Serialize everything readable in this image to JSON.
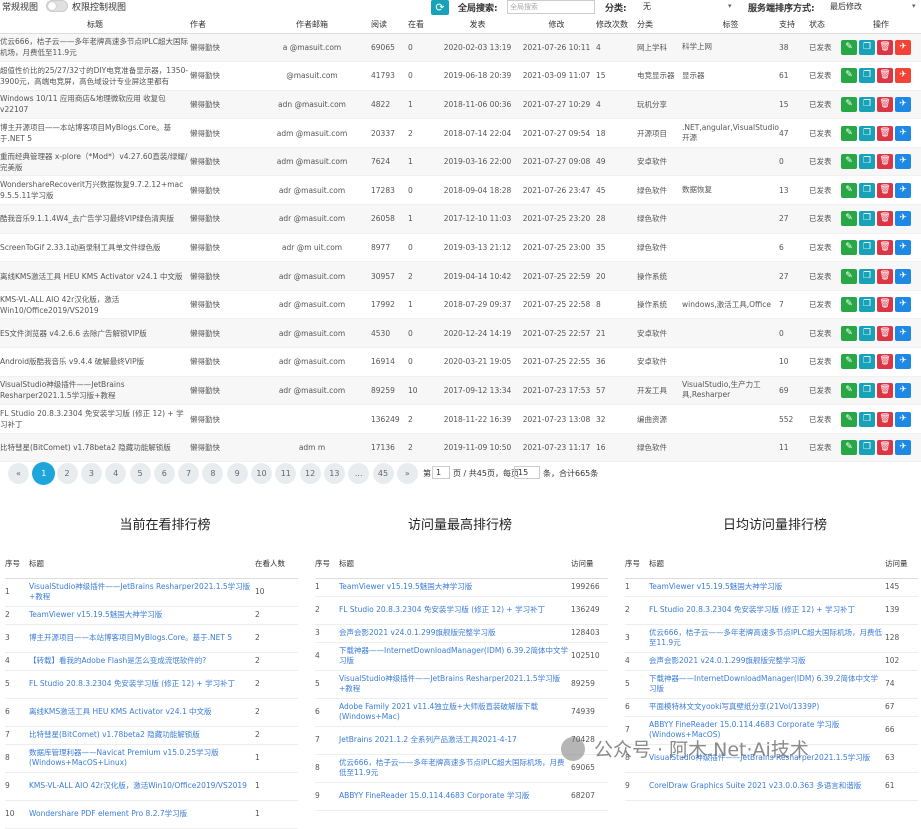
{
  "topbar": {
    "view1": "常规视图",
    "view2": "权限控制视图",
    "global_search_label": "全局搜索:",
    "search_placeholder": "全局搜索",
    "category_label": "分类:",
    "category_value": "无",
    "sort_label": "服务端排序方式:",
    "sort_value": "最后修改"
  },
  "table": {
    "headers": [
      "标题",
      "作者",
      "作者邮箱",
      "阅读",
      "在看",
      "发表",
      "修改",
      "修改次数",
      "分类",
      "标签",
      "支持",
      "状态",
      "操作"
    ],
    "rows": [
      {
        "title": "优云666，桔子云——多年老牌高速多节点IPLC超大国际机场，月费低至11.9元",
        "author": "懒得勤快",
        "email": "a    @masuit.com",
        "reads": "69065",
        "watch": "0",
        "pub": "2020-02-03 13:19",
        "mod": "2021-07-26 10:11",
        "times": "4",
        "cat": "网上学科",
        "tags": "科学上网",
        "support": "38",
        "status": "已发表",
        "extra": true
      },
      {
        "title": "超值性价比的25/27/32寸的DIY电竞准备显示器，1350-3900元，高端电竞屏，高色域设计专业屏这里都有",
        "author": "懒得勤快",
        "email": "    @masuit.com",
        "reads": "41793",
        "watch": "0",
        "pub": "2019-06-18 20:39",
        "mod": "2021-03-09 11:07",
        "times": "15",
        "cat": "电竞显示器",
        "tags": "显示器",
        "support": "61",
        "status": "已发表",
        "extra": true
      },
      {
        "title": "Windows 10/11 应用商店&地理微软应用 收复包v22107",
        "author": "懒得勤快",
        "email": "adn   @masuit.com",
        "reads": "4822",
        "watch": "1",
        "pub": "2018-11-06 00:36",
        "mod": "2021-07-27 10:29",
        "times": "4",
        "cat": "玩机分享",
        "tags": "",
        "support": "15",
        "status": "已发表",
        "extra": false
      },
      {
        "title": "博主开源项目——本站博客项目MyBlogs.Core。基于.NET 5",
        "author": "懒得勤快",
        "email": "adm  @masuit.com",
        "reads": "20337",
        "watch": "2",
        "pub": "2018-07-14 22:04",
        "mod": "2021-07-27 09:54",
        "times": "18",
        "cat": "开源项目",
        "tags": ".NET,angular,VisualStudio,开源",
        "support": "47",
        "status": "已发表",
        "extra": false
      },
      {
        "title": "重而经典管理器 x-plore（*Mod*）v4.27.60直装/绿耀/完美版",
        "author": "懒得勤快",
        "email": "adm  @masuit.com",
        "reads": "7624",
        "watch": "1",
        "pub": "2019-03-16 22:00",
        "mod": "2021-07-27 09:08",
        "times": "49",
        "cat": "安卓软件",
        "tags": "",
        "support": "0",
        "status": "已发表",
        "extra": false
      },
      {
        "title": "WondershareRecoverit万兴数据恢复9.7.2.12+mac 9.5.5.11学习版",
        "author": "懒得勤快",
        "email": "adr   @masuit.com",
        "reads": "17283",
        "watch": "0",
        "pub": "2018-09-04 18:28",
        "mod": "2021-07-26 23:47",
        "times": "45",
        "cat": "绿色软件",
        "tags": "数据恢复",
        "support": "13",
        "status": "已发表",
        "extra": false
      },
      {
        "title": "酷我音乐9.1.1.4W4_去广告学习最终VIP绿色清爽版",
        "author": "懒得勤快",
        "email": "adr   @masuit.com",
        "reads": "26058",
        "watch": "1",
        "pub": "2017-12-10 11:03",
        "mod": "2021-07-25 23:20",
        "times": "28",
        "cat": "绿色软件",
        "tags": "",
        "support": "27",
        "status": "已发表",
        "extra": false
      },
      {
        "title": "ScreenToGif 2.33.1动画录制工具单文件绿色版",
        "author": "懒得勤快",
        "email": "adr   @m  uit.com",
        "reads": "8977",
        "watch": "0",
        "pub": "2019-03-13 21:12",
        "mod": "2021-07-25 23:00",
        "times": "35",
        "cat": "绿色软件",
        "tags": "",
        "support": "6",
        "status": "已发表",
        "extra": false
      },
      {
        "title": "离线KMS激活工具 HEU KMS Activator v24.1 中文版",
        "author": "懒得勤快",
        "email": "adr   @masuit.com",
        "reads": "30957",
        "watch": "2",
        "pub": "2019-04-14 10:42",
        "mod": "2021-07-25 22:59",
        "times": "20",
        "cat": "操作系统",
        "tags": "",
        "support": "27",
        "status": "已发表",
        "extra": false
      },
      {
        "title": "KMS-VL-ALL AIO 42r汉化版，激活Win10/Office2019/VS2019",
        "author": "懒得勤快",
        "email": "adr  @masuit.com",
        "reads": "17992",
        "watch": "1",
        "pub": "2018-07-29 09:37",
        "mod": "2021-07-25 22:58",
        "times": "8",
        "cat": "操作系统",
        "tags": "windows,激活工具,Office",
        "support": "7",
        "status": "已发表",
        "extra": false
      },
      {
        "title": "ES文件浏览器 v4.2.6.6 去除广告解锁VIP版",
        "author": "懒得勤快",
        "email": "adr  @masuit.com",
        "reads": "4530",
        "watch": "0",
        "pub": "2020-12-24 14:19",
        "mod": "2021-07-25 22:57",
        "times": "21",
        "cat": "安卓软件",
        "tags": "",
        "support": "0",
        "status": "已发表",
        "extra": false
      },
      {
        "title": "Android版酷我音乐 v9.4.4 破解最终VIP版",
        "author": "懒得勤快",
        "email": "adr  @masuit.com",
        "reads": "16914",
        "watch": "0",
        "pub": "2020-03-21 19:05",
        "mod": "2021-07-25 22:55",
        "times": "36",
        "cat": "安卓软件",
        "tags": "",
        "support": "10",
        "status": "已发表",
        "extra": false
      },
      {
        "title": "VisualStudio神级插件——JetBrains Resharper2021.1.5学习版+教程",
        "author": "懒得勤快",
        "email": "adr  @masuit.com",
        "reads": "89259",
        "watch": "10",
        "pub": "2017-09-12 13:34",
        "mod": "2021-07-23 17:53",
        "times": "57",
        "cat": "开发工具",
        "tags": "VisualStudio,生产力工具,Resharper",
        "support": "69",
        "status": "已发表",
        "extra": false
      },
      {
        "title": "FL Studio 20.8.3.2304 免安装学习版 (修正 12) + 学习补丁",
        "author": "懒得勤快",
        "email": "",
        "reads": "136249",
        "watch": "2",
        "pub": "2018-11-22 16:39",
        "mod": "2021-07-23 13:08",
        "times": "32",
        "cat": "编曲资源",
        "tags": "",
        "support": "552",
        "status": "已发表",
        "extra": false
      },
      {
        "title": "比特彗星(BitComet) v1.78beta2 隐藏功能解锁版",
        "author": "懒得勤快",
        "email": "adm           m",
        "reads": "17136",
        "watch": "2",
        "pub": "2019-11-09 10:50",
        "mod": "2021-07-23 11:17",
        "times": "16",
        "cat": "绿色软件",
        "tags": "",
        "support": "11",
        "status": "已发表",
        "extra": false
      }
    ]
  },
  "pager": {
    "prev": "«",
    "pages": [
      "1",
      "2",
      "3",
      "4",
      "5",
      "6",
      "7",
      "8",
      "9",
      "10",
      "11",
      "12",
      "13",
      "...",
      "45"
    ],
    "next": "»",
    "label_page": "第",
    "current": "1",
    "label_total": "页 / 共45页，每页",
    "per_page": "15",
    "label_count": "条，合计665条"
  },
  "ranks": [
    {
      "title": "当前在看排行榜",
      "h_no": "序号",
      "h_title": "标题",
      "h_val": "在看人数",
      "rows": [
        {
          "no": "1",
          "t": "VisualStudio神级插件——JetBrains Resharper2021.1.5学习版+教程",
          "v": "10"
        },
        {
          "no": "2",
          "t": "TeamViewer v15.19.5魅国大神学习版",
          "v": "2"
        },
        {
          "no": "3",
          "t": "博主开源项目——本站博客项目MyBlogs.Core。基于.NET 5",
          "v": "2"
        },
        {
          "no": "4",
          "t": "【转载】看我的Adobe Flash是怎么变成流氓软件的?",
          "v": "2"
        },
        {
          "no": "5",
          "t": "FL Studio 20.8.3.2304 免安装学习版 (修正 12) + 学习补丁",
          "v": "2"
        },
        {
          "no": "6",
          "t": "离线KMS激活工具 HEU KMS Activator v24.1 中文版",
          "v": "2"
        },
        {
          "no": "7",
          "t": "比特彗星(BitComet) v1.78beta2 隐藏功能解锁版",
          "v": "2"
        },
        {
          "no": "8",
          "t": "数据库管理利器——Navicat Premium v15.0.25学习版(Windows+MacOS+Linux)",
          "v": "1"
        },
        {
          "no": "9",
          "t": "KMS-VL-ALL AIO 42r汉化版，激活Win10/Office2019/VS2019",
          "v": "1"
        },
        {
          "no": "10",
          "t": "Wondershare PDF element Pro 8.2.7学习版",
          "v": "1"
        }
      ]
    },
    {
      "title": "访问量最高排行榜",
      "h_no": "序号",
      "h_title": "标题",
      "h_val": "访问量",
      "rows": [
        {
          "no": "1",
          "t": "TeamViewer v15.19.5魅国大神学习版",
          "v": "199266"
        },
        {
          "no": "2",
          "t": "FL Studio 20.8.3.2304 免安装学习版 (修正 12) + 学习补丁",
          "v": "136249"
        },
        {
          "no": "3",
          "t": "会声会影2021 v24.0.1.299旗舰版完整学习版",
          "v": "128403"
        },
        {
          "no": "4",
          "t": "下载神器——InternetDownloadManager(IDM) 6.39.2简体中文学习版",
          "v": "102510"
        },
        {
          "no": "5",
          "t": "VisualStudio神级插件——JetBrains Resharper2021.1.5学习版+教程",
          "v": "89259"
        },
        {
          "no": "6",
          "t": "Adobe Family 2021 v11.4独立版+大师版直装破解版下载(Windows+Mac)",
          "v": "74939"
        },
        {
          "no": "7",
          "t": "JetBrains 2021.1.2 全系列产品激活工具2021-4-17",
          "v": "70428"
        },
        {
          "no": "8",
          "t": "优云666，桔子云——多年老牌高速多节点IPLC超大国际机场，月费低至11.9元",
          "v": "69065"
        },
        {
          "no": "9",
          "t": "ABBYY FineReader 15.0.114.4683 Corporate 学习版",
          "v": "68207"
        }
      ]
    },
    {
      "title": "日均访问量排行榜",
      "h_no": "序号",
      "h_title": "标题",
      "h_val": "访问量",
      "rows": [
        {
          "no": "1",
          "t": "TeamViewer v15.19.5魅国大神学习版",
          "v": "145"
        },
        {
          "no": "2",
          "t": "FL Studio 20.8.3.2304 免安装学习版 (修正 12) + 学习补丁",
          "v": "139"
        },
        {
          "no": "3",
          "t": "优云666，桔子云——多年老牌高速多节点IPLC超大国际机场，月费低至11.9元",
          "v": "128"
        },
        {
          "no": "4",
          "t": "会声会影2021 v24.0.1.299旗舰版完整学习版",
          "v": "102"
        },
        {
          "no": "5",
          "t": "下载神器——InternetDownloadManager(IDM) 6.39.2简体中文学习版",
          "v": "74"
        },
        {
          "no": "6",
          "t": "平面模特林文文yooki写真壁纸分享(21Vol/1339P)",
          "v": "67"
        },
        {
          "no": "7",
          "t": "ABBYY FineReader 15.0.114.4683 Corporate 学习版(Windows+MacOS)",
          "v": "66"
        },
        {
          "no": "8",
          "t": "VisualStudio神级插件——JetBrains Resharper2021.1.5学习版",
          "v": "63"
        },
        {
          "no": "9",
          "t": "CorelDraw Graphics Suite 2021 v23.0.0.363 多语言和谐版",
          "v": "61"
        }
      ]
    }
  ],
  "watermark": "公众号 · 阿木.Net·Ai技术"
}
